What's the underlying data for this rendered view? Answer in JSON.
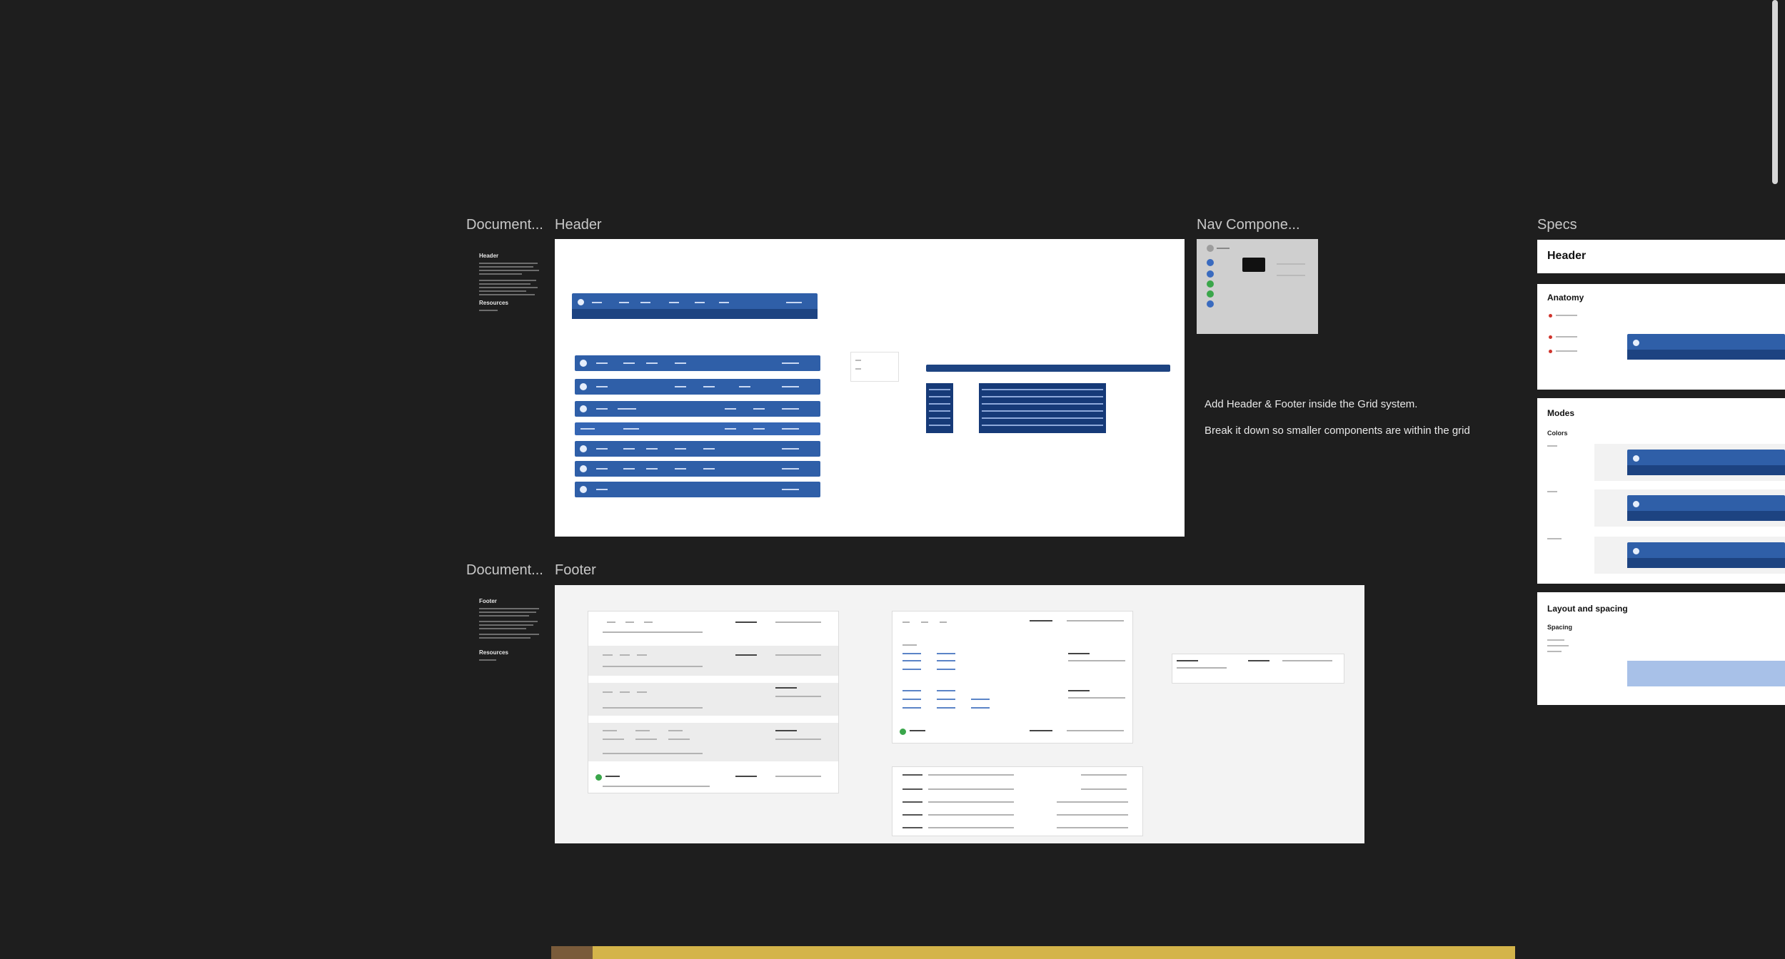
{
  "canvas": {
    "labels": {
      "doc_header": "Document...",
      "header": "Header",
      "nav_component": "Nav Compone...",
      "specs": "Specs",
      "doc_footer": "Document...",
      "footer": "Footer"
    }
  },
  "doc_panel_header": {
    "title": "Header",
    "resources": "Resources"
  },
  "doc_panel_footer": {
    "title": "Footer",
    "resources": "Resources"
  },
  "notes": {
    "line1": "Add Header & Footer inside the Grid system.",
    "line2": "Break it down so smaller components are within the grid"
  },
  "specs": {
    "header_card": "Header",
    "anatomy": "Anatomy",
    "modes": "Modes",
    "colors": "Colors",
    "layout": "Layout and spacing",
    "spacing": "Spacing"
  },
  "colors": {
    "canvas_bg": "#1e1e1e",
    "nav_blue": "#2f5fa8",
    "nav_dark_blue": "#1d4381",
    "dropdown": "#163a78",
    "accent_bar": "#d4b44a"
  }
}
